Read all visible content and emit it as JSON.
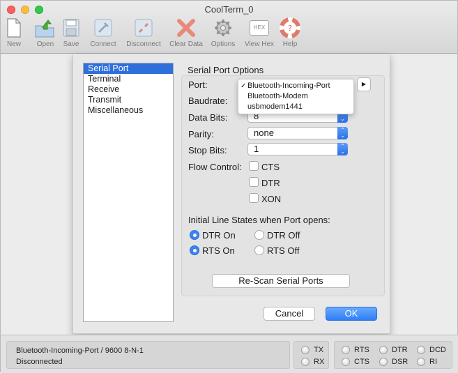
{
  "window": {
    "title": "CoolTerm_0"
  },
  "toolbar": [
    {
      "label": "New",
      "icon": "new-document-icon"
    },
    {
      "label": "Open",
      "icon": "open-folder-icon"
    },
    {
      "label": "Save",
      "icon": "save-floppy-icon"
    },
    {
      "label": "Connect",
      "icon": "connect-plug-icon"
    },
    {
      "label": "Disconnect",
      "icon": "disconnect-plug-icon"
    },
    {
      "label": "Clear Data",
      "icon": "clear-x-icon"
    },
    {
      "label": "Options",
      "icon": "gear-icon"
    },
    {
      "label": "View Hex",
      "icon": "hex-icon",
      "icon_text": "HEX"
    },
    {
      "label": "Help",
      "icon": "lifebuoy-icon"
    }
  ],
  "sidebar": {
    "items": [
      {
        "label": "Serial Port",
        "selected": true
      },
      {
        "label": "Terminal"
      },
      {
        "label": "Receive"
      },
      {
        "label": "Transmit"
      },
      {
        "label": "Miscellaneous"
      }
    ]
  },
  "options": {
    "title": "Serial Port Options",
    "port_label": "Port:",
    "port_dropdown": {
      "items": [
        {
          "label": "Bluetooth-Incoming-Port",
          "checked": true
        },
        {
          "label": "Bluetooth-Modem"
        },
        {
          "label": "usbmodem1441"
        }
      ]
    },
    "baudrate_label": "Baudrate:",
    "databits_label": "Data Bits:",
    "databits_value": "8",
    "parity_label": "Parity:",
    "parity_value": "none",
    "stopbits_label": "Stop Bits:",
    "stopbits_value": "1",
    "flow_label": "Flow Control:",
    "flow": {
      "cts": "CTS",
      "dtr": "DTR",
      "xon": "XON"
    },
    "initial_title": "Initial Line States when Port opens:",
    "dtr_on": "DTR On",
    "dtr_off": "DTR Off",
    "rts_on": "RTS On",
    "rts_off": "RTS Off",
    "rescan_button": "Re-Scan Serial Ports"
  },
  "dialog": {
    "cancel": "Cancel",
    "ok": "OK"
  },
  "status": {
    "line1": "Bluetooth-Incoming-Port / 9600 8-N-1",
    "line2": "Disconnected",
    "signals": [
      "TX",
      "RX",
      "RTS",
      "CTS",
      "DTR",
      "DSR",
      "DCD",
      "RI"
    ]
  },
  "colors": {
    "accent": "#2f6fdc",
    "ok_button": "#2d7ef6"
  }
}
